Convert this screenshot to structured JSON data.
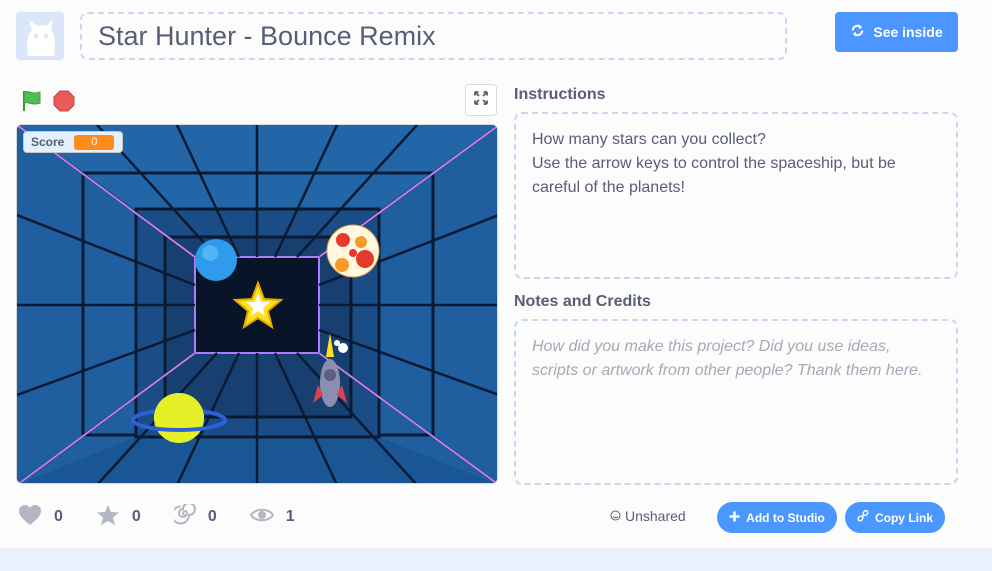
{
  "project": {
    "title": "Star Hunter - Bounce Remix",
    "see_inside_label": "See inside"
  },
  "stage": {
    "monitor_label": "Score",
    "monitor_value": "0"
  },
  "instructions": {
    "heading": "Instructions",
    "text": "How many stars can you collect?\nUse the arrow keys to control the spaceship, but be careful of the planets!"
  },
  "notes": {
    "heading": "Notes and Credits",
    "placeholder": "How did you make this project? Did you use ideas, scripts or artwork from other people? Thank them here."
  },
  "stats": {
    "loves": "0",
    "favorites": "0",
    "remixes": "0",
    "views": "1"
  },
  "sharing": {
    "status": "Unshared",
    "add_to_studio_label": "Add to Studio",
    "copy_link_label": "Copy Link"
  },
  "colors": {
    "accent": "#4c97ff",
    "text": "#575e75",
    "flag_green": "#4cbf56",
    "stop_red": "#ec5959",
    "score_orange": "#ff8c1a"
  },
  "icons": {
    "avatar": "cat-avatar-icon",
    "see_inside": "remix-arrows-icon",
    "flag": "green-flag-icon",
    "stop": "stop-icon",
    "fullscreen": "fullscreen-icon",
    "loves": "heart-icon",
    "favorites": "star-icon",
    "remixes": "remix-spiral-icon",
    "views": "eye-icon",
    "unshared": "unshared-icon",
    "add": "plus-icon",
    "link": "link-icon"
  }
}
